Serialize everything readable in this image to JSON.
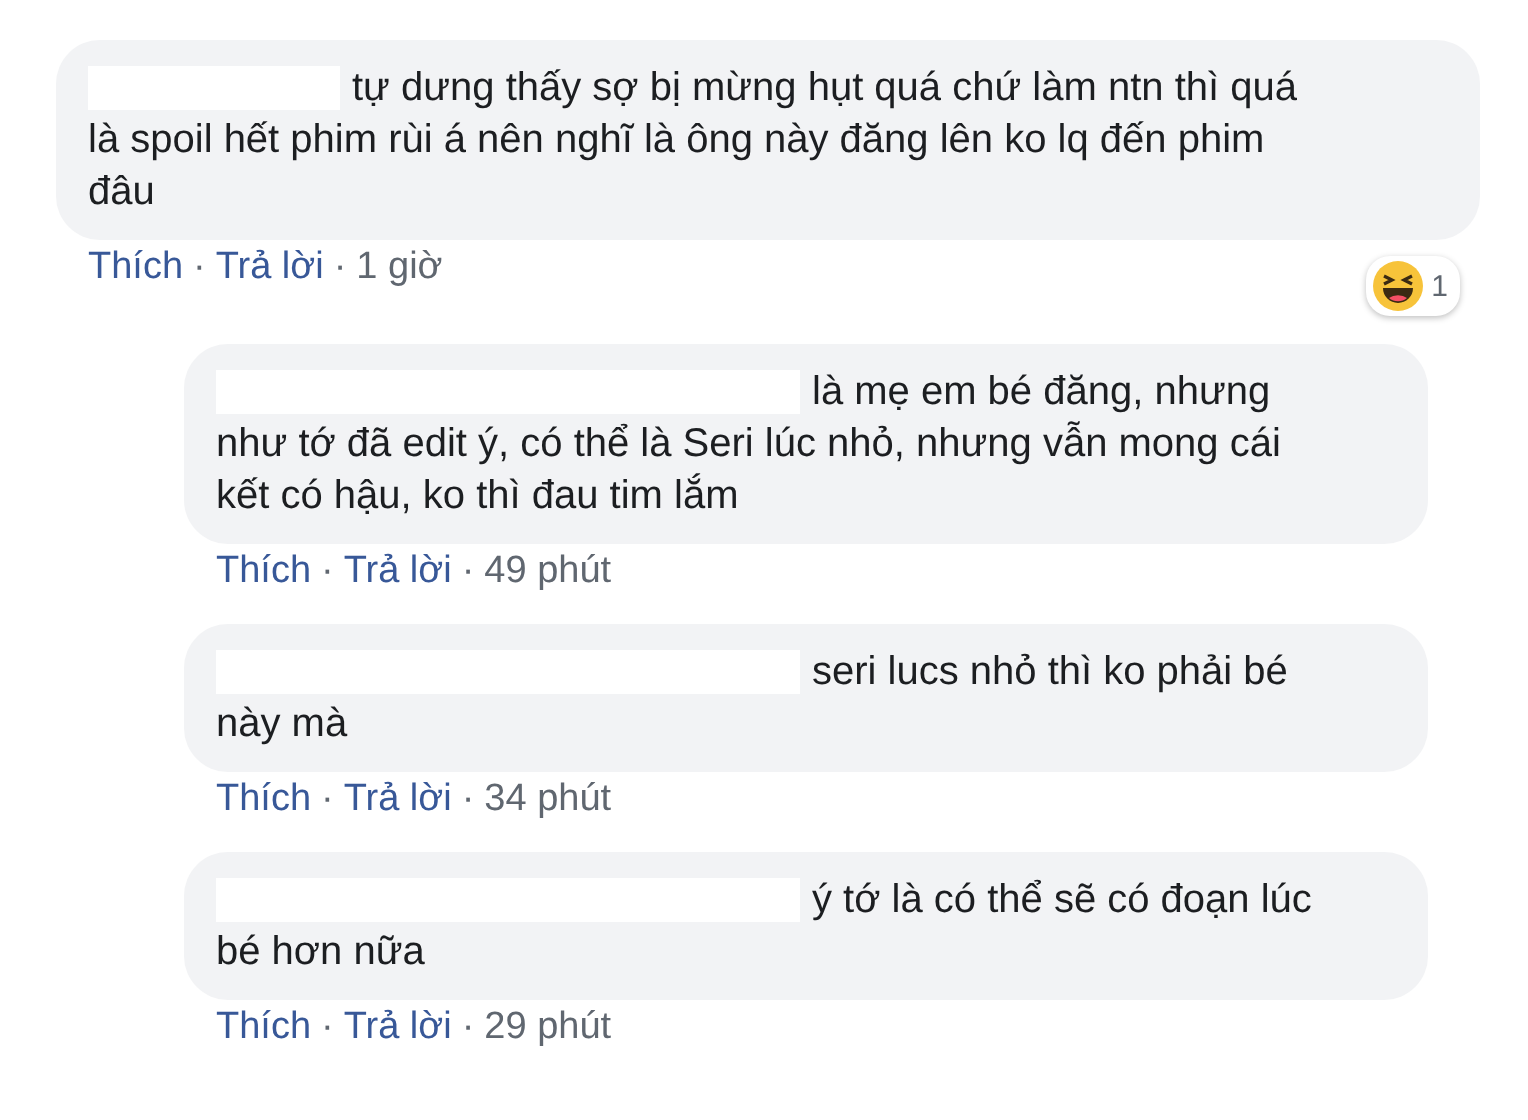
{
  "comments": [
    {
      "text": "tự dưng thấy sợ bị mừng hụt quá chứ làm ntn thì quá là spoil hết phim rùi á nên nghĩ là ông này đăng lên ko lq đến phim đâu",
      "like": "Thích",
      "reply": "Trả lời",
      "separators": [
        "·",
        "·"
      ],
      "time": "1 giờ",
      "reaction_count": "1",
      "replies": [
        {
          "text": "là mẹ em bé đăng, nhưng như tớ đã edit ý, có thể là Seri lúc nhỏ, nhưng vẫn mong cái kết có hậu, ko thì đau tim lắm",
          "like": "Thích",
          "reply": "Trả lời",
          "separators": [
            "·",
            "·"
          ],
          "time": "49 phút"
        },
        {
          "text": "seri lucs nhỏ thì ko phải bé này mà",
          "like": "Thích",
          "reply": "Trả lời",
          "separators": [
            "·",
            "·"
          ],
          "time": "34 phút"
        },
        {
          "text": "ý tớ là có thể sẽ có đoạn lúc bé hơn nữa",
          "like": "Thích",
          "reply": "Trả lời",
          "separators": [
            "·",
            "·"
          ],
          "time": "29 phút"
        }
      ]
    }
  ]
}
